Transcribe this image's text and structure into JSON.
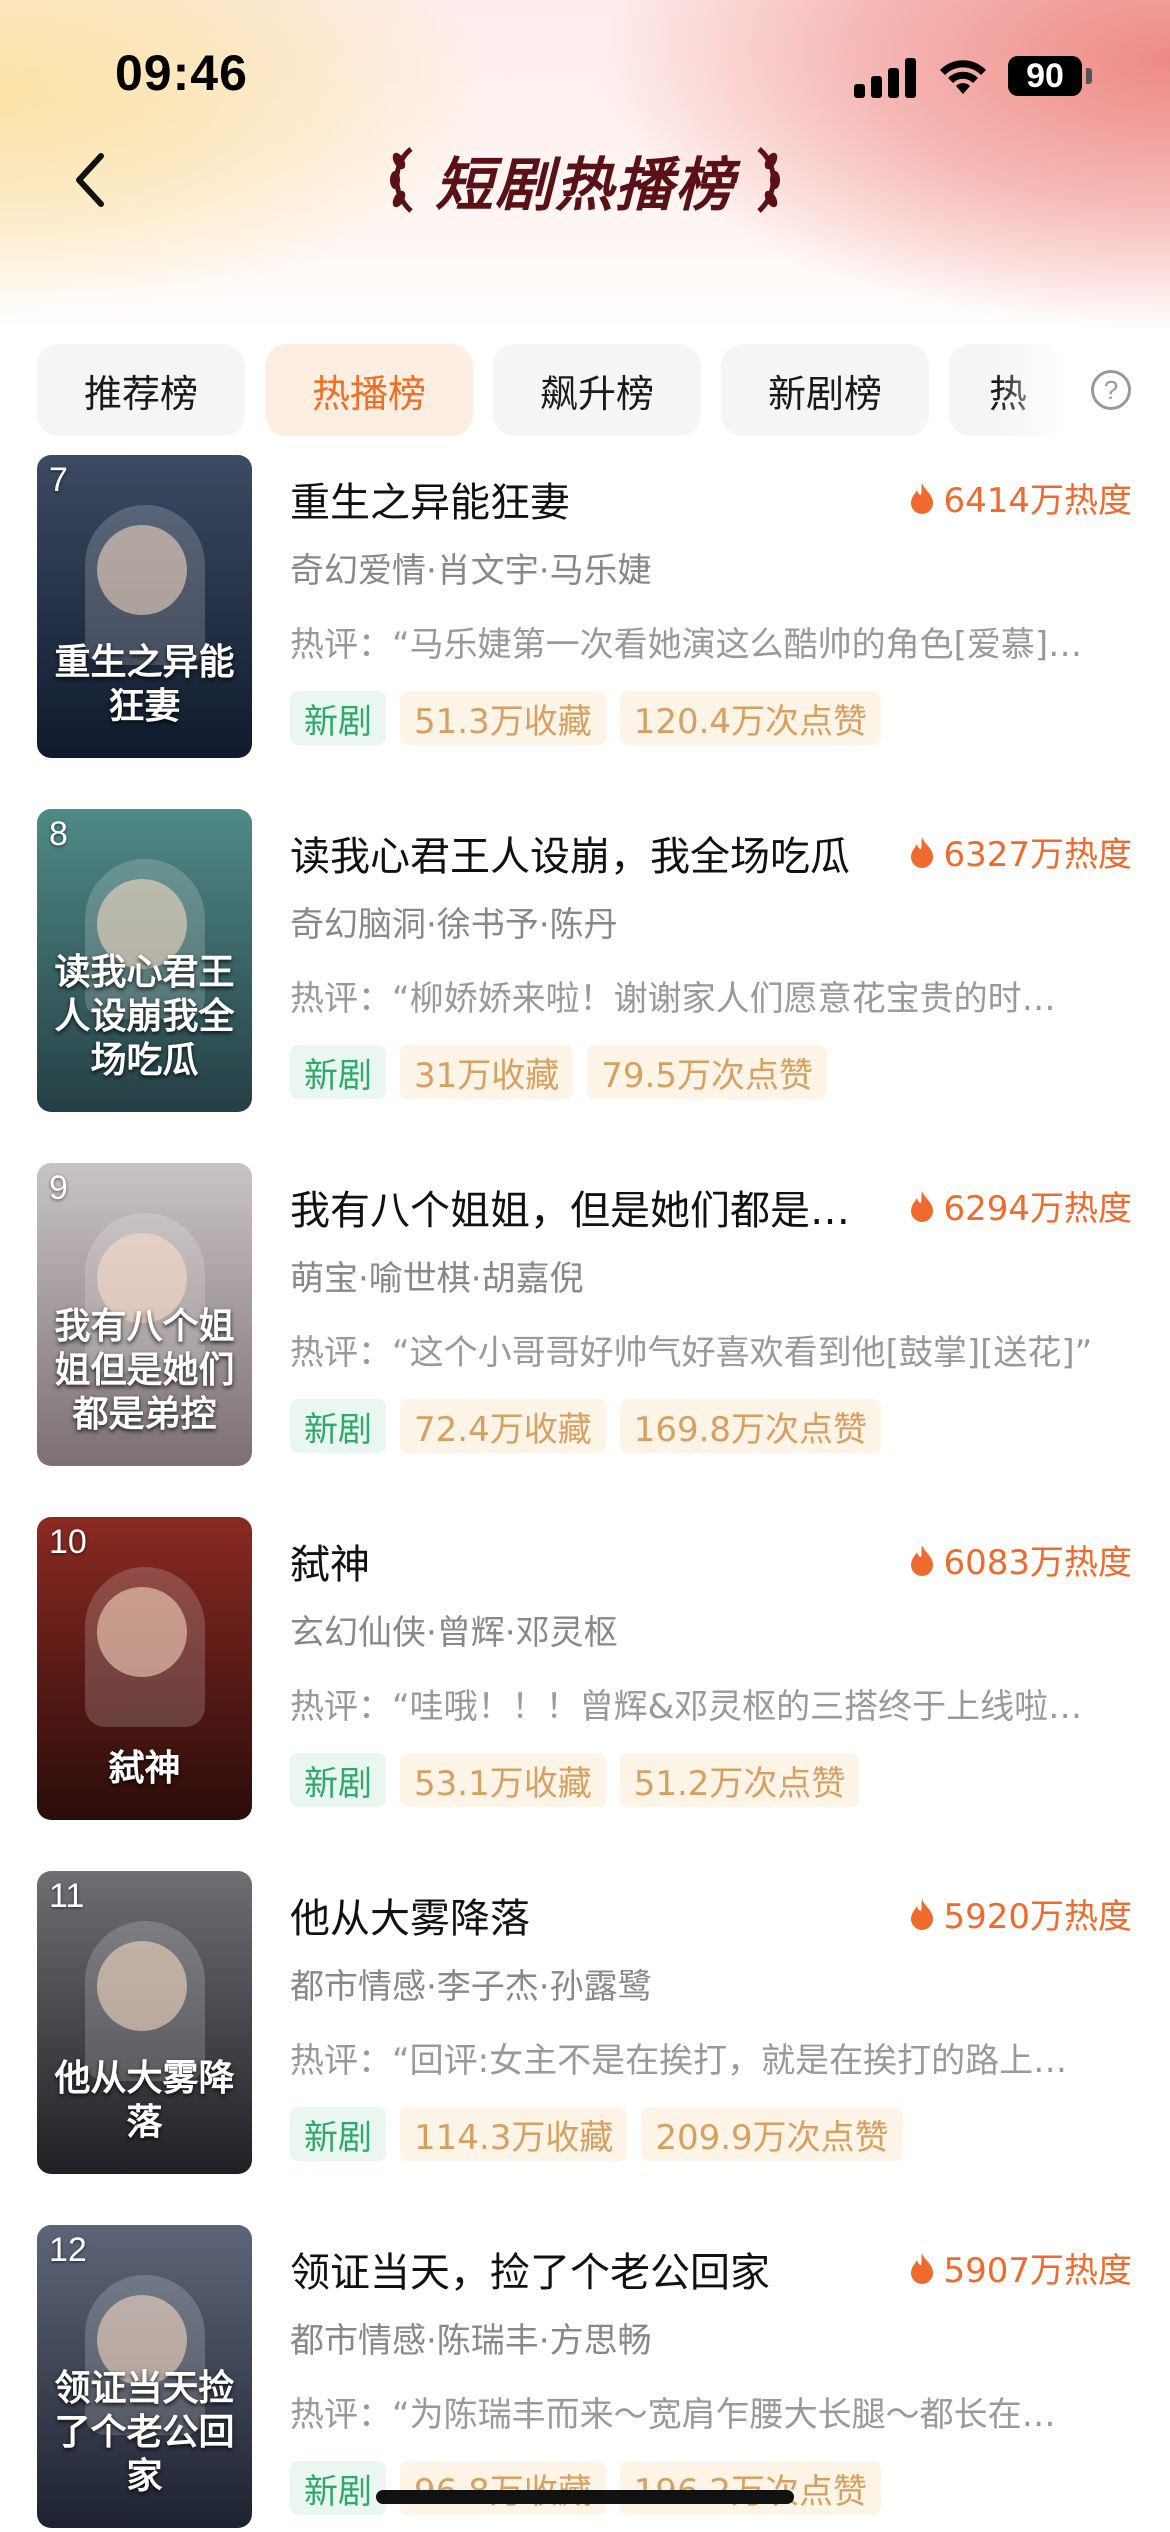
{
  "status_bar": {
    "time": "09:46",
    "battery": "90"
  },
  "nav": {
    "title": "短剧热播榜"
  },
  "tabs": [
    {
      "label": "推荐榜",
      "active": false
    },
    {
      "label": "热播榜",
      "active": true
    },
    {
      "label": "飙升榜",
      "active": false
    },
    {
      "label": "新剧榜",
      "active": false
    },
    {
      "label": "热",
      "active": false
    }
  ],
  "help": "?",
  "items": [
    {
      "rank": "7",
      "title": "重生之异能狂妻",
      "heat": "6414万热度",
      "meta": "奇幻爱情·肖文宇·马乐婕",
      "review": "热评：“马乐婕第一次看她演这么酷帅的角色[爱慕]…",
      "tag_new": "新剧",
      "favorites": "51.3万收藏",
      "likes": "120.4万次点赞",
      "poster_text": "重生之异能狂妻",
      "poster_colors": [
        "#3c4a63",
        "#0f1a2c"
      ]
    },
    {
      "rank": "8",
      "title": "读我心君王人设崩，我全场吃瓜",
      "heat": "6327万热度",
      "meta": "奇幻脑洞·徐书予·陈丹",
      "review": "热评：“柳娇娇来啦！谢谢家人们愿意花宝贵的时…",
      "tag_new": "新剧",
      "favorites": "31万收藏",
      "likes": "79.5万次点赞",
      "poster_text": "读我心君王人设崩我全场吃瓜",
      "poster_colors": [
        "#4f8a86",
        "#253f45"
      ]
    },
    {
      "rank": "9",
      "title": "我有八个姐姐，但是她们都是…",
      "heat": "6294万热度",
      "meta": "萌宝·喻世棋·胡嘉倪",
      "review": "热评：“这个小哥哥好帅气好喜欢看到他[鼓掌][送花]”",
      "tag_new": "新剧",
      "favorites": "72.4万收藏",
      "likes": "169.8万次点赞",
      "poster_text": "我有八个姐姐但是她们都是弟控",
      "poster_colors": [
        "#c9c4c4",
        "#7c6f72"
      ]
    },
    {
      "rank": "10",
      "title": "弑神",
      "heat": "6083万热度",
      "meta": "玄幻仙侠·曾辉·邓灵枢",
      "review": "热评：“哇哦！！！曾辉&邓灵枢的三搭终于上线啦…",
      "tag_new": "新剧",
      "favorites": "53.1万收藏",
      "likes": "51.2万次点赞",
      "poster_text": "弑神",
      "poster_colors": [
        "#8a2a22",
        "#2a0c0a"
      ]
    },
    {
      "rank": "11",
      "title": "他从大雾降落",
      "heat": "5920万热度",
      "meta": "都市情感·李子杰·孙露鹭",
      "review": "热评：“回评:女主不是在挨打，就是在挨打的路上…",
      "tag_new": "新剧",
      "favorites": "114.3万收藏",
      "likes": "209.9万次点赞",
      "poster_text": "他从大雾降落",
      "poster_colors": [
        "#6d6f74",
        "#1e2026"
      ]
    },
    {
      "rank": "12",
      "title": "领证当天，捡了个老公回家",
      "heat": "5907万热度",
      "meta": "都市情感·陈瑞丰·方思畅",
      "review": "热评：“为陈瑞丰而来～宽肩乍腰大长腿～都长在…",
      "tag_new": "新剧",
      "favorites": "96.8万收藏",
      "likes": "196.2万次点赞",
      "poster_text": "领证当天捡了个老公回家",
      "poster_colors": [
        "#5d6678",
        "#1d2230"
      ]
    }
  ]
}
